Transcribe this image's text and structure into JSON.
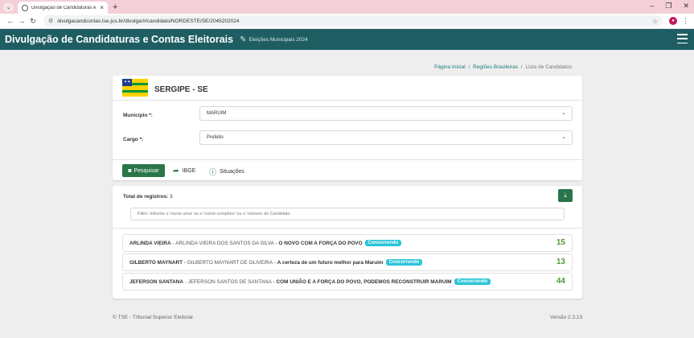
{
  "browser": {
    "tab_title": "Divulgação de Candidaturas e",
    "url": "divulgacandcontas.tse.jus.br/divulga/#/candidato/NORDESTE/SE/2045202024"
  },
  "header": {
    "title": "Divulgação de Candidaturas e Contas Eleitorais",
    "subtitle": "Eleições Municipais 2024"
  },
  "breadcrumb": {
    "items": [
      "Página Inicial",
      "Regiões Brasileiras",
      "Lista de Candidatos"
    ]
  },
  "filters": {
    "state": "SERGIPE - SE",
    "municipio_label": "Município *:",
    "municipio_value": "MARUIM",
    "cargo_label": "Cargo *:",
    "cargo_value": "Prefeito",
    "search_label": "Pesquisar",
    "ibge_label": "IBGE",
    "situacoes_label": "Situações"
  },
  "results": {
    "total_label": "Total de registros:",
    "total_value": "3",
    "filter_placeholder": "Filtro: Informe o 'nome urna' ou o 'nome completo' ou o 'número do Candidato",
    "candidates": [
      {
        "urna": "ARLINDA VIEIRA",
        "completo": "ARLINDA VIEIRA DOS SANTOS DA SILVA",
        "coligacao": "O NOVO COM A FORÇA DO POVO",
        "status": "Concorrendo",
        "numero": "15"
      },
      {
        "urna": "GILBERTO MAYNART",
        "completo": "GILBERTO MAYNART DE OLIVEIRA",
        "coligacao": "A certeza de um futuro melhor para Maruim",
        "status": "Concorrendo",
        "numero": "13"
      },
      {
        "urna": "JEFERSON SANTANA",
        "completo": "JEFERSON SANTOS DE SANTANA",
        "coligacao": "COM UNIÃO E A FORÇA DO POVO, PODEMOS RECONSTRUIR MARUIM",
        "status": "Concorrendo",
        "numero": "44"
      }
    ]
  },
  "footer": {
    "left": "© TSE - Tribunal Superior Eleitoral",
    "right": "Versão 2.3.13"
  },
  "colors": {
    "appbar": "#1e5e62",
    "primary_button": "#28754a",
    "badge": "#29c4d8",
    "number": "#4f9a36"
  }
}
